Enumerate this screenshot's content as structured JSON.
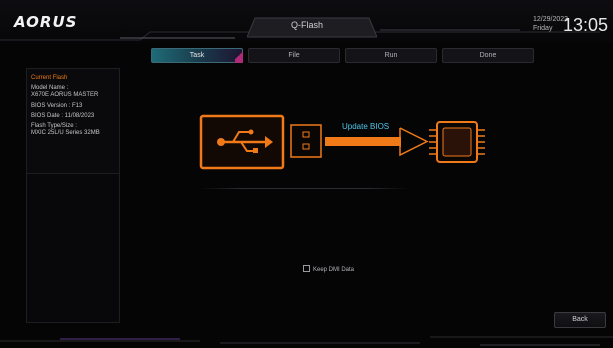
{
  "header": {
    "logo": "AORUS",
    "title": "Q-Flash",
    "date_line1": "12/29/2023",
    "date_line2": "Friday",
    "time": "13:05"
  },
  "steps": [
    {
      "label": "Task",
      "active": true
    },
    {
      "label": "File",
      "active": false
    },
    {
      "label": "Run",
      "active": false
    },
    {
      "label": "Done",
      "active": false
    }
  ],
  "info": {
    "heading": "Current Flash",
    "lines": [
      "Model Name :",
      "X670E AORUS MASTER",
      "BIOS Version : F13",
      "BIOS Date : 11/08/2023",
      "Flash Type/Size :",
      "MXIC 25L/U Series  32MB"
    ]
  },
  "illustration": {
    "action_label": "Update BIOS",
    "source_icon": "usb-icon",
    "target_icon": "chip-icon"
  },
  "options": {
    "keep_dmi_label": "Keep DMI Data",
    "keep_dmi_checked": false
  },
  "buttons": {
    "back_label": "Back"
  },
  "colors": {
    "accent_orange": "#f07a18",
    "accent_cyan": "#4fc6ea",
    "tab_active": "#1f6b78"
  }
}
